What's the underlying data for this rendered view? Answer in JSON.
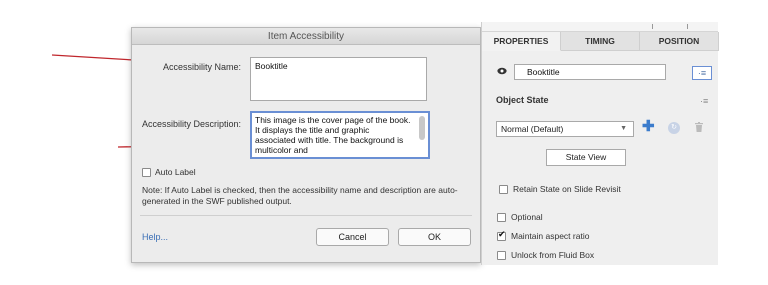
{
  "dialog": {
    "title": "Item Accessibility",
    "name_label": "Accessibility Name:",
    "name_value": "Booktitle",
    "description_label": "Accessibility Description:",
    "description_value": "This image is the cover page of the book. It displays the title and graphic associated with title. The background is multicolor and",
    "auto_label": "Auto Label",
    "auto_label_checked": false,
    "note": "Note: If Auto Label is checked, then the accessibility name and description are auto-generated in the SWF published output.",
    "help_link": "Help...",
    "cancel_label": "Cancel",
    "ok_label": "OK"
  },
  "panel": {
    "tabs": [
      "PROPERTIES",
      "TIMING",
      "POSITION"
    ],
    "active_tab": "PROPERTIES",
    "item_name": "Booktitle",
    "object_state_title": "Object State",
    "state_select_value": "Normal (Default)",
    "state_view_label": "State View",
    "retain_state_label": "Retain State on Slide Revisit",
    "retain_state_checked": false,
    "optional_label": "Optional",
    "optional_checked": false,
    "maintain_aspect_label": "Maintain aspect ratio",
    "maintain_aspect_checked": true,
    "unlock_fluid_label": "Unlock from Fluid Box",
    "unlock_fluid_checked": false
  },
  "icons": {
    "eye": "eye-icon",
    "list": "list-icon",
    "menu": "menu-icon",
    "plus": "plus-icon",
    "refresh": "circle-icon",
    "trash": "trash-icon"
  },
  "colors": {
    "annotation_arrow": "#c0262c",
    "accent_blue": "#3b7ccc",
    "focus_border": "#6a8fd4"
  }
}
